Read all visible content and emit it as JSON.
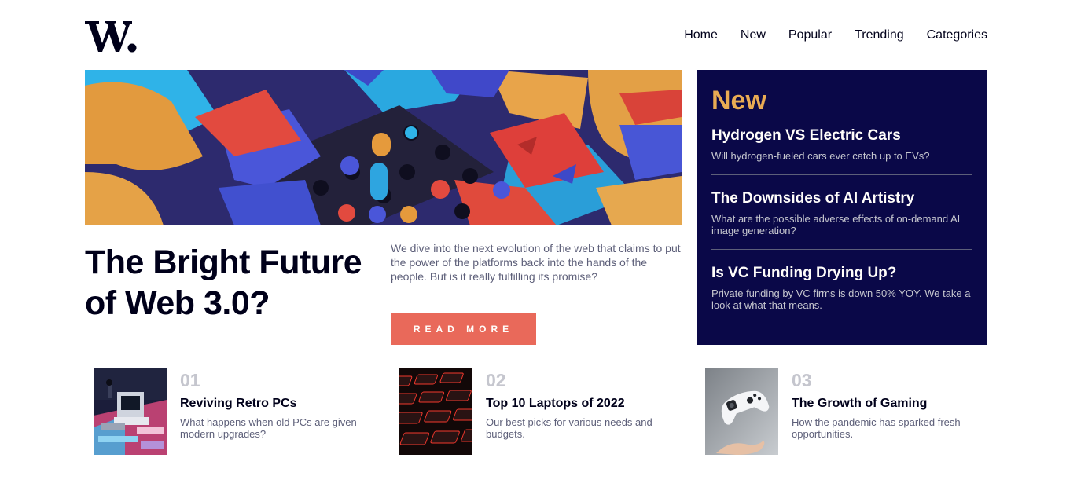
{
  "logo": {
    "alt": "W."
  },
  "nav": {
    "items": [
      "Home",
      "New",
      "Popular",
      "Trending",
      "Categories"
    ]
  },
  "hero": {
    "title": "The Bright Future of Web 3.0?",
    "description": "We dive into the next evolution of the web that claims to put the power of the platforms back into the hands of the people. But is it really fulfilling its promise?",
    "button_label": "READ MORE"
  },
  "new_panel": {
    "heading": "New",
    "items": [
      {
        "title": "Hydrogen VS Electric Cars",
        "description": "Will hydrogen-fueled cars ever catch up to EVs?"
      },
      {
        "title": "The Downsides of AI Artistry",
        "description": "What are the possible adverse effects of on-demand AI image generation?"
      },
      {
        "title": "Is VC Funding Drying Up?",
        "description": "Private funding by VC firms is down 50% YOY. We take a look at what that means."
      }
    ]
  },
  "cards": [
    {
      "number": "01",
      "title": "Reviving Retro PCs",
      "description": "What happens when old PCs are given modern upgrades?"
    },
    {
      "number": "02",
      "title": "Top 10 Laptops of 2022",
      "description": "Our best picks for various needs and budgets."
    },
    {
      "number": "03",
      "title": "The Growth of Gaming",
      "description": "How the pandemic has sparked fresh opportunities."
    }
  ],
  "colors": {
    "accent": "#e9695a",
    "panel_bg": "#0a0848",
    "panel_heading": "#e9ab53",
    "text_dark": "#00001a",
    "text_muted": "#5d5f79",
    "number_gray": "#c5c6ce"
  }
}
